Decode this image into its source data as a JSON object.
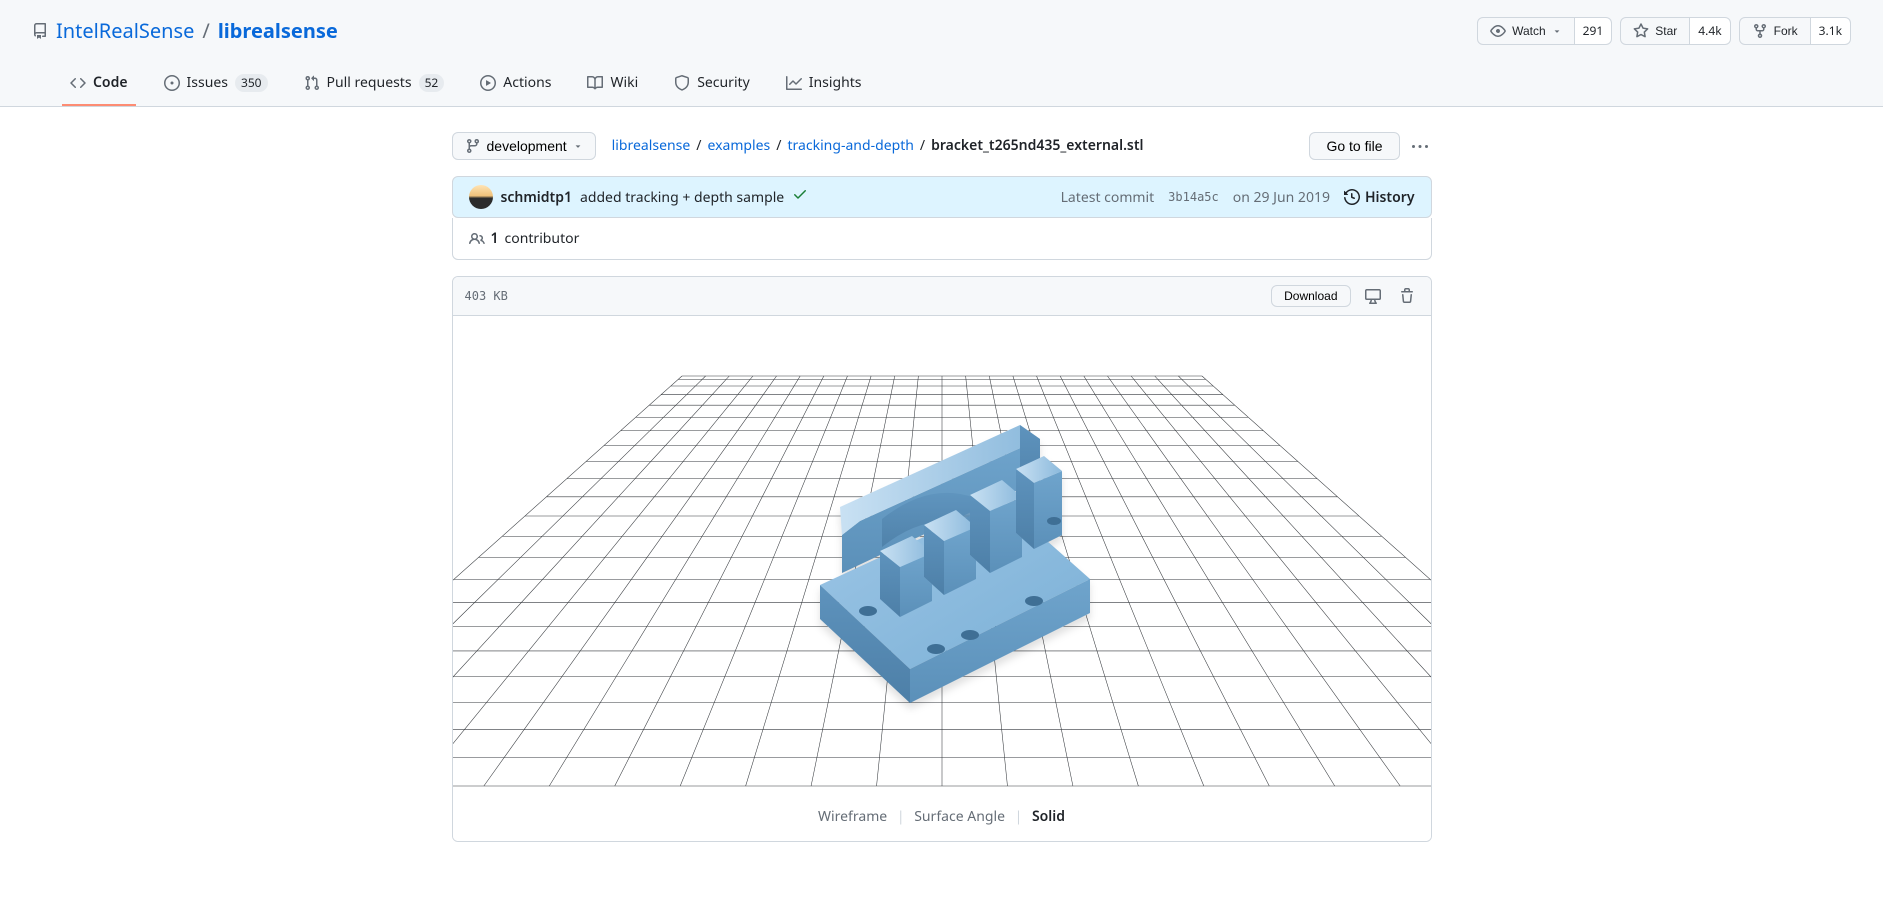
{
  "repo": {
    "owner": "IntelRealSense",
    "name": "librealsense"
  },
  "actions": {
    "watch_label": "Watch",
    "watch_count": "291",
    "star_label": "Star",
    "star_count": "4.4k",
    "fork_label": "Fork",
    "fork_count": "3.1k"
  },
  "tabs": {
    "code": "Code",
    "issues": "Issues",
    "issues_count": "350",
    "prs": "Pull requests",
    "prs_count": "52",
    "actions": "Actions",
    "wiki": "Wiki",
    "security": "Security",
    "insights": "Insights"
  },
  "branch": "development",
  "breadcrumb": {
    "p0": "librealsense",
    "p1": "examples",
    "p2": "tracking-and-depth",
    "file": "bracket_t265nd435_external.stl"
  },
  "go_to_file": "Go to file",
  "commit": {
    "author": "schmidtp1",
    "message": "added tracking + depth sample",
    "latest_label": "Latest commit",
    "sha": "3b14a5c",
    "date": "on 29 Jun 2019",
    "history_label": "History"
  },
  "contributors": {
    "count": "1",
    "label": "contributor"
  },
  "file": {
    "size": "403 KB",
    "download": "Download"
  },
  "viewer": {
    "mode_wireframe": "Wireframe",
    "mode_surface": "Surface Angle",
    "mode_solid": "Solid"
  }
}
